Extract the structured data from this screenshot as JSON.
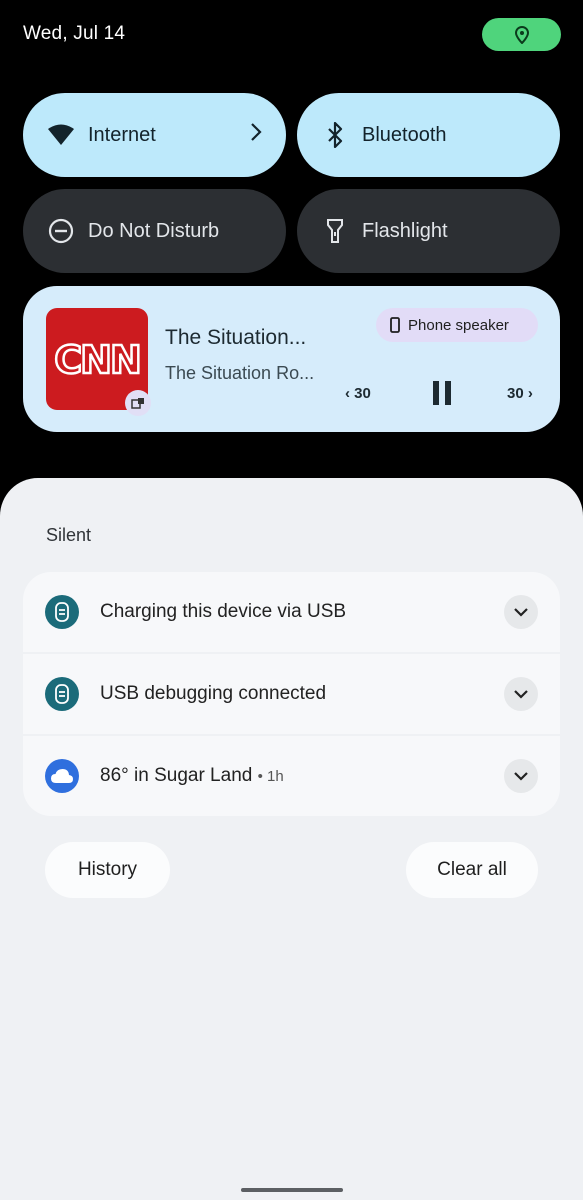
{
  "status_bar": {
    "date": "Wed, Jul 14",
    "location_chip_color": "#4fd47c"
  },
  "quick_settings": {
    "internet": {
      "label": "Internet",
      "icon": "wifi-icon",
      "active": true
    },
    "bluetooth": {
      "label": "Bluetooth",
      "icon": "bluetooth-icon",
      "active": true
    },
    "dnd": {
      "label": "Do Not Disturb",
      "icon": "do-not-disturb-icon",
      "active": false
    },
    "flashlight": {
      "label": "Flashlight",
      "icon": "flashlight-icon",
      "active": false
    }
  },
  "media": {
    "album_text": "CNN",
    "title": "The Situation...",
    "subtitle": "The Situation Ro...",
    "output_chip": "Phone speaker",
    "rewind_label": "30",
    "forward_label": "30",
    "state": "playing"
  },
  "notifications": {
    "section_label": "Silent",
    "items": [
      {
        "text": "Charging this device via USB",
        "icon": "usb-icon",
        "icon_color": "#1b6b7a"
      },
      {
        "text": "USB debugging connected",
        "icon": "usb-icon",
        "icon_color": "#1b6b7a"
      },
      {
        "text": "86° in Sugar Land",
        "time": "• 1h",
        "icon": "cloud-icon",
        "icon_color": "#2f6fde"
      }
    ]
  },
  "actions": {
    "history": "History",
    "clear_all": "Clear all"
  },
  "colors": {
    "tile_active": "#bde9fb",
    "tile_inactive": "#2c2f33",
    "media_bg": "#d6ecfb",
    "shade_bg": "#eff1f4"
  }
}
